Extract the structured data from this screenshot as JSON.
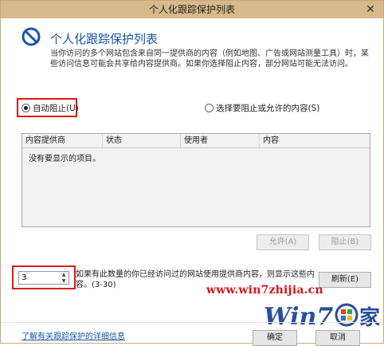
{
  "window": {
    "title": "个人化跟踪保护列表",
    "close_glyph": "✕"
  },
  "header": {
    "title": "个人化跟踪保护列表",
    "description": "当你访问的多个网站包含来自同一提供商的内容（例如地图、广告或网站测量工具）时，某些访问信息可能会共享给内容提供商。如果你选择阻止内容，部分网站可能无法访问。"
  },
  "options": {
    "auto_block": {
      "label": "自动阻止(U)",
      "checked": true
    },
    "choose": {
      "label": "选择要阻止或允许的内容(S)",
      "checked": false
    }
  },
  "list": {
    "columns": [
      "内容提供商",
      "状态",
      "使用者",
      "内容"
    ],
    "empty_message": "没有要显示的项目。"
  },
  "buttons": {
    "allow": "允许(A)",
    "block": "阻止(B)",
    "refresh": "刷新(E)",
    "ok": "确定",
    "cancel": "取消"
  },
  "threshold": {
    "value": "3",
    "text": "如果有此数量的你已经访问过的网站使用提供商内容，则显示这些内容。(3-30)"
  },
  "watermark": {
    "url": "www.win7zhijia.cn",
    "logo_text": "Win7",
    "logo_suffix": "家"
  },
  "footer": {
    "learn_link": "了解有关跟踪保护的详细信息"
  },
  "colors": {
    "accent": "#1a56a8",
    "highlight": "#e01818",
    "titlebar": "#d8b98a"
  }
}
